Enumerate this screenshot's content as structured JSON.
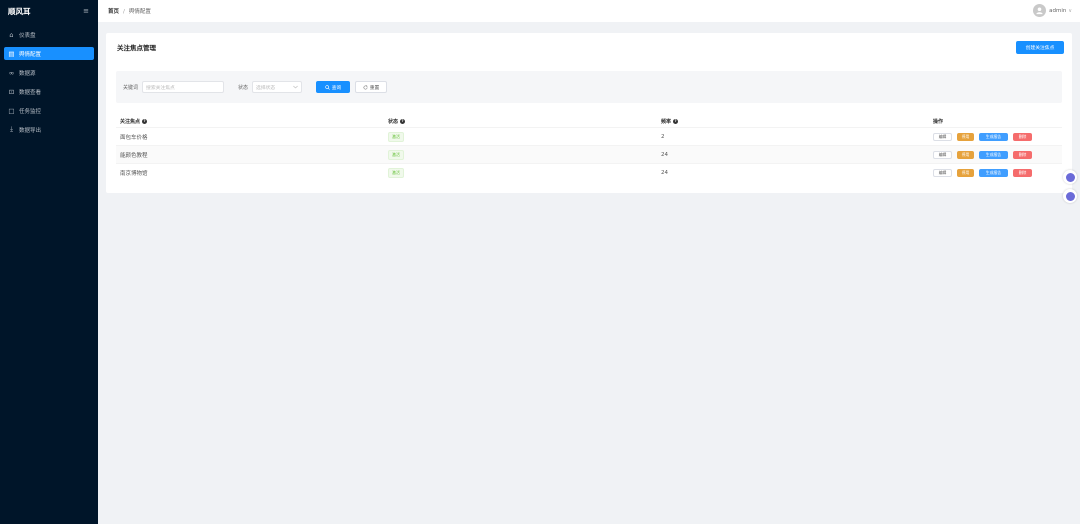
{
  "app": {
    "logo": "顺风耳",
    "menu_toggle": "≡"
  },
  "sidebar": {
    "items": [
      {
        "label": "仪表盘",
        "icon": "home-icon",
        "glyph": "⌂",
        "active": false
      },
      {
        "label": "舆情配置",
        "icon": "document-icon",
        "glyph": "▤",
        "active": true
      },
      {
        "label": "数据源",
        "icon": "link-icon",
        "glyph": "∞",
        "active": false
      },
      {
        "label": "数据查看",
        "icon": "cart-icon",
        "glyph": "⊡",
        "active": false
      },
      {
        "label": "任务监控",
        "icon": "monitor-icon",
        "glyph": "□",
        "active": false
      },
      {
        "label": "数据导出",
        "icon": "download-icon",
        "glyph": "⤓",
        "active": false
      }
    ]
  },
  "breadcrumb": {
    "home": "首页",
    "separator": "/",
    "current": "舆情配置"
  },
  "user": {
    "name": "admin",
    "chevron": "∨"
  },
  "card": {
    "title": "关注焦点管理",
    "create_button": "创建关注焦点"
  },
  "filters": {
    "keyword_label": "关键词",
    "keyword_placeholder": "搜索关注焦点",
    "status_label": "状态",
    "status_placeholder": "选择状态",
    "query_button": "查询",
    "reset_button": "重置"
  },
  "table": {
    "headers": [
      "关注焦点",
      "状态",
      "频率",
      "操作"
    ],
    "rows": [
      {
        "focus": "面包车价格",
        "status": "激活",
        "frequency": "2"
      },
      {
        "focus": "能颜色教程",
        "status": "激活",
        "frequency": "24"
      },
      {
        "focus": "南京博物馆",
        "status": "激活",
        "frequency": "24"
      }
    ],
    "actions": {
      "edit": "编辑",
      "stop": "停用",
      "report": "生成报告",
      "delete": "删除"
    }
  },
  "colors": {
    "sidebar": "#001529",
    "primary": "#1890ff",
    "warning": "#e6a23c",
    "danger": "#f56c6c",
    "success": "#67c23a"
  }
}
